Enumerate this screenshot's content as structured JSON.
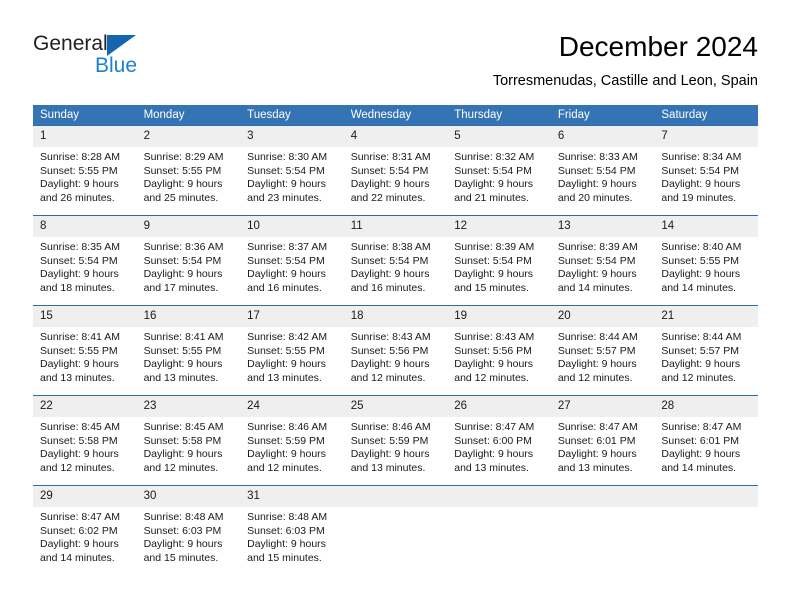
{
  "brand": {
    "name_top": "General",
    "name_bottom": "Blue",
    "accent_color": "#1b7fd4",
    "triangle_color": "#1466b0"
  },
  "header": {
    "title": "December 2024",
    "subtitle": "Torresmenudas, Castille and Leon, Spain"
  },
  "theme": {
    "header_bg": "#3474b4",
    "header_text": "#ffffff",
    "daynum_bg": "#efefef",
    "cell_border": "#2e6da4"
  },
  "weekday_headers": [
    "Sunday",
    "Monday",
    "Tuesday",
    "Wednesday",
    "Thursday",
    "Friday",
    "Saturday"
  ],
  "weeks": [
    [
      {
        "day": "1",
        "sunrise": "Sunrise: 8:28 AM",
        "sunset": "Sunset: 5:55 PM",
        "daylight_line1": "Daylight: 9 hours",
        "daylight_line2": "and 26 minutes."
      },
      {
        "day": "2",
        "sunrise": "Sunrise: 8:29 AM",
        "sunset": "Sunset: 5:55 PM",
        "daylight_line1": "Daylight: 9 hours",
        "daylight_line2": "and 25 minutes."
      },
      {
        "day": "3",
        "sunrise": "Sunrise: 8:30 AM",
        "sunset": "Sunset: 5:54 PM",
        "daylight_line1": "Daylight: 9 hours",
        "daylight_line2": "and 23 minutes."
      },
      {
        "day": "4",
        "sunrise": "Sunrise: 8:31 AM",
        "sunset": "Sunset: 5:54 PM",
        "daylight_line1": "Daylight: 9 hours",
        "daylight_line2": "and 22 minutes."
      },
      {
        "day": "5",
        "sunrise": "Sunrise: 8:32 AM",
        "sunset": "Sunset: 5:54 PM",
        "daylight_line1": "Daylight: 9 hours",
        "daylight_line2": "and 21 minutes."
      },
      {
        "day": "6",
        "sunrise": "Sunrise: 8:33 AM",
        "sunset": "Sunset: 5:54 PM",
        "daylight_line1": "Daylight: 9 hours",
        "daylight_line2": "and 20 minutes."
      },
      {
        "day": "7",
        "sunrise": "Sunrise: 8:34 AM",
        "sunset": "Sunset: 5:54 PM",
        "daylight_line1": "Daylight: 9 hours",
        "daylight_line2": "and 19 minutes."
      }
    ],
    [
      {
        "day": "8",
        "sunrise": "Sunrise: 8:35 AM",
        "sunset": "Sunset: 5:54 PM",
        "daylight_line1": "Daylight: 9 hours",
        "daylight_line2": "and 18 minutes."
      },
      {
        "day": "9",
        "sunrise": "Sunrise: 8:36 AM",
        "sunset": "Sunset: 5:54 PM",
        "daylight_line1": "Daylight: 9 hours",
        "daylight_line2": "and 17 minutes."
      },
      {
        "day": "10",
        "sunrise": "Sunrise: 8:37 AM",
        "sunset": "Sunset: 5:54 PM",
        "daylight_line1": "Daylight: 9 hours",
        "daylight_line2": "and 16 minutes."
      },
      {
        "day": "11",
        "sunrise": "Sunrise: 8:38 AM",
        "sunset": "Sunset: 5:54 PM",
        "daylight_line1": "Daylight: 9 hours",
        "daylight_line2": "and 16 minutes."
      },
      {
        "day": "12",
        "sunrise": "Sunrise: 8:39 AM",
        "sunset": "Sunset: 5:54 PM",
        "daylight_line1": "Daylight: 9 hours",
        "daylight_line2": "and 15 minutes."
      },
      {
        "day": "13",
        "sunrise": "Sunrise: 8:39 AM",
        "sunset": "Sunset: 5:54 PM",
        "daylight_line1": "Daylight: 9 hours",
        "daylight_line2": "and 14 minutes."
      },
      {
        "day": "14",
        "sunrise": "Sunrise: 8:40 AM",
        "sunset": "Sunset: 5:55 PM",
        "daylight_line1": "Daylight: 9 hours",
        "daylight_line2": "and 14 minutes."
      }
    ],
    [
      {
        "day": "15",
        "sunrise": "Sunrise: 8:41 AM",
        "sunset": "Sunset: 5:55 PM",
        "daylight_line1": "Daylight: 9 hours",
        "daylight_line2": "and 13 minutes."
      },
      {
        "day": "16",
        "sunrise": "Sunrise: 8:41 AM",
        "sunset": "Sunset: 5:55 PM",
        "daylight_line1": "Daylight: 9 hours",
        "daylight_line2": "and 13 minutes."
      },
      {
        "day": "17",
        "sunrise": "Sunrise: 8:42 AM",
        "sunset": "Sunset: 5:55 PM",
        "daylight_line1": "Daylight: 9 hours",
        "daylight_line2": "and 13 minutes."
      },
      {
        "day": "18",
        "sunrise": "Sunrise: 8:43 AM",
        "sunset": "Sunset: 5:56 PM",
        "daylight_line1": "Daylight: 9 hours",
        "daylight_line2": "and 12 minutes."
      },
      {
        "day": "19",
        "sunrise": "Sunrise: 8:43 AM",
        "sunset": "Sunset: 5:56 PM",
        "daylight_line1": "Daylight: 9 hours",
        "daylight_line2": "and 12 minutes."
      },
      {
        "day": "20",
        "sunrise": "Sunrise: 8:44 AM",
        "sunset": "Sunset: 5:57 PM",
        "daylight_line1": "Daylight: 9 hours",
        "daylight_line2": "and 12 minutes."
      },
      {
        "day": "21",
        "sunrise": "Sunrise: 8:44 AM",
        "sunset": "Sunset: 5:57 PM",
        "daylight_line1": "Daylight: 9 hours",
        "daylight_line2": "and 12 minutes."
      }
    ],
    [
      {
        "day": "22",
        "sunrise": "Sunrise: 8:45 AM",
        "sunset": "Sunset: 5:58 PM",
        "daylight_line1": "Daylight: 9 hours",
        "daylight_line2": "and 12 minutes."
      },
      {
        "day": "23",
        "sunrise": "Sunrise: 8:45 AM",
        "sunset": "Sunset: 5:58 PM",
        "daylight_line1": "Daylight: 9 hours",
        "daylight_line2": "and 12 minutes."
      },
      {
        "day": "24",
        "sunrise": "Sunrise: 8:46 AM",
        "sunset": "Sunset: 5:59 PM",
        "daylight_line1": "Daylight: 9 hours",
        "daylight_line2": "and 12 minutes."
      },
      {
        "day": "25",
        "sunrise": "Sunrise: 8:46 AM",
        "sunset": "Sunset: 5:59 PM",
        "daylight_line1": "Daylight: 9 hours",
        "daylight_line2": "and 13 minutes."
      },
      {
        "day": "26",
        "sunrise": "Sunrise: 8:47 AM",
        "sunset": "Sunset: 6:00 PM",
        "daylight_line1": "Daylight: 9 hours",
        "daylight_line2": "and 13 minutes."
      },
      {
        "day": "27",
        "sunrise": "Sunrise: 8:47 AM",
        "sunset": "Sunset: 6:01 PM",
        "daylight_line1": "Daylight: 9 hours",
        "daylight_line2": "and 13 minutes."
      },
      {
        "day": "28",
        "sunrise": "Sunrise: 8:47 AM",
        "sunset": "Sunset: 6:01 PM",
        "daylight_line1": "Daylight: 9 hours",
        "daylight_line2": "and 14 minutes."
      }
    ],
    [
      {
        "day": "29",
        "sunrise": "Sunrise: 8:47 AM",
        "sunset": "Sunset: 6:02 PM",
        "daylight_line1": "Daylight: 9 hours",
        "daylight_line2": "and 14 minutes."
      },
      {
        "day": "30",
        "sunrise": "Sunrise: 8:48 AM",
        "sunset": "Sunset: 6:03 PM",
        "daylight_line1": "Daylight: 9 hours",
        "daylight_line2": "and 15 minutes."
      },
      {
        "day": "31",
        "sunrise": "Sunrise: 8:48 AM",
        "sunset": "Sunset: 6:03 PM",
        "daylight_line1": "Daylight: 9 hours",
        "daylight_line2": "and 15 minutes."
      },
      {
        "day": "",
        "sunrise": "",
        "sunset": "",
        "daylight_line1": "",
        "daylight_line2": ""
      },
      {
        "day": "",
        "sunrise": "",
        "sunset": "",
        "daylight_line1": "",
        "daylight_line2": ""
      },
      {
        "day": "",
        "sunrise": "",
        "sunset": "",
        "daylight_line1": "",
        "daylight_line2": ""
      },
      {
        "day": "",
        "sunrise": "",
        "sunset": "",
        "daylight_line1": "",
        "daylight_line2": ""
      }
    ]
  ]
}
